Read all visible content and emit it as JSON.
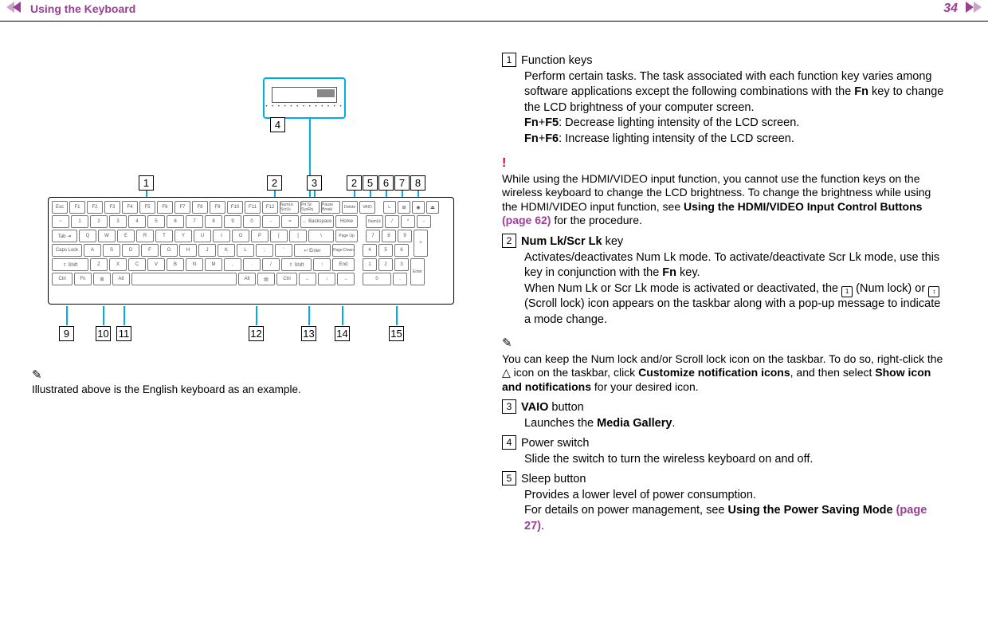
{
  "header": {
    "title": "Using the Keyboard",
    "page": "34"
  },
  "leftNote": "Illustrated above is the English keyboard as an example.",
  "callouts": {
    "top": [
      "1",
      "2",
      "3",
      "2",
      "5",
      "6",
      "7",
      "8"
    ],
    "powerBox": "4",
    "bottom": [
      "9",
      "10",
      "11",
      "12",
      "13",
      "14",
      "15"
    ]
  },
  "right": {
    "item1": {
      "num": "1",
      "title": "Function keys",
      "body1": "Perform certain tasks. The task associated with each function key varies among software applications except the following combinations with the ",
      "fn": "Fn",
      "body2": " key to change the LCD brightness of your computer screen.",
      "fnf5_label": "Fn",
      "fnf5_plus": "+",
      "fnf5_key": "F5",
      "fnf5_desc": ": Decrease lighting intensity of the LCD screen.",
      "fnf6_label": "Fn",
      "fnf6_plus": "+",
      "fnf6_key": "F6",
      "fnf6_desc": ": Increase lighting intensity of the LCD screen."
    },
    "warn1_a": "While using the HDMI/VIDEO input function, you cannot use the function keys on the wireless keyboard to change the LCD brightness. To change the brightness while using the HDMI/VIDEO input function, see ",
    "warn1_b": "Using the HDMI/VIDEO Input Control Buttons ",
    "warn1_link": "(page 62)",
    "warn1_c": " for the procedure.",
    "item2": {
      "num": "2",
      "titleA": "Num Lk",
      "slash": "/",
      "titleB": "Scr Lk",
      "titleTail": " key",
      "line1a": "Activates/deactivates Num Lk mode. To activate/deactivate Scr Lk mode, use this key in conjunction with the ",
      "fn": "Fn",
      "line1b": " key.",
      "line2": "When Num Lk or Scr Lk mode is activated or deactivated, the ",
      "numlockLabel": " (Num lock) or ",
      "scrolllockLabel": " (Scroll lock) icon appears on the taskbar along with a pop-up message to indicate a mode change."
    },
    "tip_a": "You can keep the Num lock and/or Scroll lock icon on the taskbar. To do so, right-click the △ icon on the taskbar, click ",
    "tip_b": "Customize notification icons",
    "tip_c": ", and then select ",
    "tip_d": "Show icon and notifications",
    "tip_e": " for your desired icon.",
    "item3": {
      "num": "3",
      "title": "VAIO",
      "tail": " button",
      "body_a": "Launches the ",
      "body_b": "Media Gallery",
      "body_c": "."
    },
    "item4": {
      "num": "4",
      "title": "Power switch",
      "body": "Slide the switch to turn the wireless keyboard on and off."
    },
    "item5": {
      "num": "5",
      "title": "Sleep button",
      "body1": "Provides a lower level of power consumption.",
      "body2a": "For details on power management, see ",
      "body2b": "Using the Power Saving Mode ",
      "body2link": "(page 27)",
      "body2c": "."
    }
  }
}
